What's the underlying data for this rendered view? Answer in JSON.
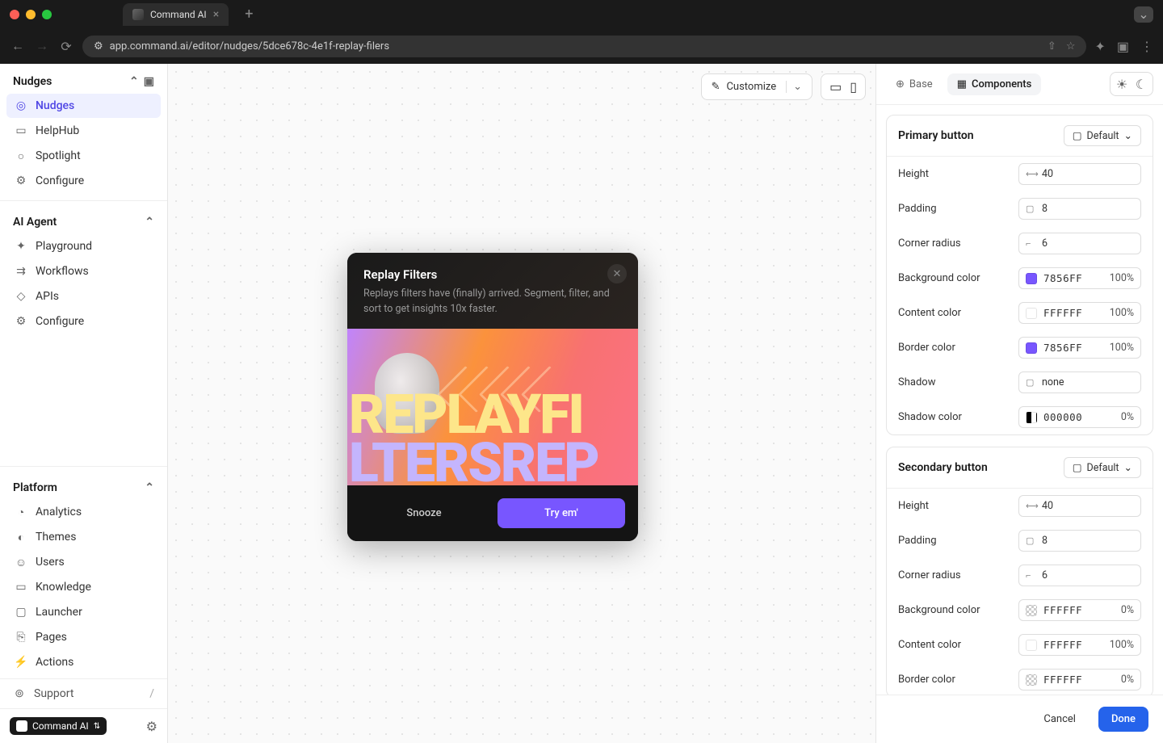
{
  "browser": {
    "tab_title": "Command AI",
    "url": "app.command.ai/editor/nudges/5dce678c-4e1f-replay-filers"
  },
  "sidebar": {
    "sections": {
      "nudges": {
        "title": "Nudges",
        "items": [
          {
            "label": "Nudges"
          },
          {
            "label": "HelpHub"
          },
          {
            "label": "Spotlight"
          },
          {
            "label": "Configure"
          }
        ]
      },
      "ai_agent": {
        "title": "AI Agent",
        "items": [
          {
            "label": "Playground"
          },
          {
            "label": "Workflows"
          },
          {
            "label": "APIs"
          },
          {
            "label": "Configure"
          }
        ]
      },
      "platform": {
        "title": "Platform",
        "items": [
          {
            "label": "Analytics"
          },
          {
            "label": "Themes"
          },
          {
            "label": "Users"
          },
          {
            "label": "Knowledge"
          },
          {
            "label": "Launcher"
          },
          {
            "label": "Pages"
          },
          {
            "label": "Actions"
          }
        ]
      }
    },
    "support": {
      "label": "Support",
      "shortcut": "/"
    },
    "footer": {
      "brand": "Command AI"
    }
  },
  "canvas": {
    "customize_label": "Customize"
  },
  "nudge": {
    "title": "Replay Filters",
    "description": "Replays filters have (finally) arrived. Segment, filter, and sort to get insights 10x faster.",
    "snooze_label": "Snooze",
    "primary_label": "Try em'",
    "bg_text_1": "REPLAYFI",
    "bg_text_2": "LTERSREP"
  },
  "right_panel": {
    "tabs": {
      "base": "Base",
      "components": "Components"
    },
    "primary": {
      "title": "Primary button",
      "variant": "Default",
      "height": {
        "label": "Height",
        "value": "40"
      },
      "padding": {
        "label": "Padding",
        "value": "8"
      },
      "corner": {
        "label": "Corner radius",
        "value": "6"
      },
      "bgcolor": {
        "label": "Background color",
        "hex": "7856FF",
        "pct": "100%"
      },
      "contentcolor": {
        "label": "Content color",
        "hex": "FFFFFF",
        "pct": "100%"
      },
      "bordercolor": {
        "label": "Border color",
        "hex": "7856FF",
        "pct": "100%"
      },
      "shadow": {
        "label": "Shadow",
        "value": "none"
      },
      "shadowcolor": {
        "label": "Shadow color",
        "hex": "000000",
        "pct": "0%"
      }
    },
    "secondary": {
      "title": "Secondary button",
      "variant": "Default",
      "height": {
        "label": "Height",
        "value": "40"
      },
      "padding": {
        "label": "Padding",
        "value": "8"
      },
      "corner": {
        "label": "Corner radius",
        "value": "6"
      },
      "bgcolor": {
        "label": "Background color",
        "hex": "FFFFFF",
        "pct": "0%"
      },
      "contentcolor": {
        "label": "Content color",
        "hex": "FFFFFF",
        "pct": "100%"
      },
      "bordercolor": {
        "label": "Border color",
        "hex": "FFFFFF",
        "pct": "0%"
      }
    },
    "footer": {
      "cancel": "Cancel",
      "done": "Done"
    }
  }
}
